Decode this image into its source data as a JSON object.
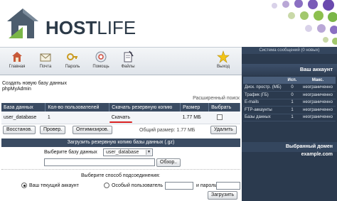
{
  "brand": {
    "name_bold": "HOST",
    "name_light": "LIFE"
  },
  "toolbar": {
    "items": [
      {
        "label": "Главная",
        "icon": "home-icon"
      },
      {
        "label": "Почта",
        "icon": "mail-icon"
      },
      {
        "label": "Пароль",
        "icon": "key-icon"
      },
      {
        "label": "Помощь",
        "icon": "help-icon"
      },
      {
        "label": "Файлы",
        "icon": "files-icon"
      },
      {
        "label": "Выход",
        "icon": "star-exit-icon"
      }
    ]
  },
  "main": {
    "line1": "Создать новую базу данных",
    "line2": "phpMyAdmin",
    "ext_search": "Расширенный поиск",
    "table": {
      "headers": [
        "База данных",
        "Кол-во пользователей",
        "Скачать резервную копию",
        "Размер",
        "Выбрать"
      ],
      "rows": [
        {
          "db": "user_database",
          "users": "1",
          "download": "Скачать",
          "size": "1.77 МБ"
        }
      ]
    },
    "buttons": {
      "restore": "Восстанов.",
      "check": "Провер.",
      "optimize": "Оптимизиров.",
      "delete": "Удалить"
    },
    "total_size": "Общий размер: 1.77 МБ",
    "upload": {
      "title": "Загрузить резервную копию базы данных (.gz)",
      "choose_db_label": "Выберите базу данных",
      "choose_db_value": "user_database",
      "browse_button": "Обзор..",
      "conn_label": "Выберите способ подсоединения:",
      "opt_current": "Ваш текущий аккаунт",
      "opt_custom": "Особый пользователь",
      "and_password": "и пароль",
      "submit": "Загрузить"
    }
  },
  "sidebar": {
    "messages": "Система сообщений (0 новых)",
    "account_title": "Ваш аккаунт",
    "columns": [
      "",
      "Исп.",
      "Макс."
    ],
    "rows": [
      {
        "name": "Диск. простр. (МБ)",
        "used": "0",
        "max": "неограниченно"
      },
      {
        "name": "Трафик (ГБ)",
        "used": "0",
        "max": "неограниченно"
      },
      {
        "name": "E-mails",
        "used": "1",
        "max": "неограниченно"
      },
      {
        "name": "FTP-аккаунты",
        "used": "1",
        "max": "неограниченно"
      },
      {
        "name": "Базы данных",
        "used": "1",
        "max": "неограниченно"
      }
    ],
    "domain_title": "Выбранный домен",
    "domain_value": "example.com"
  },
  "colors": {
    "header_dark": "#3a4b62",
    "sidebar_bg": "#2b3a4e",
    "accent_red": "#d92121",
    "logo_green": "#7ab648"
  }
}
